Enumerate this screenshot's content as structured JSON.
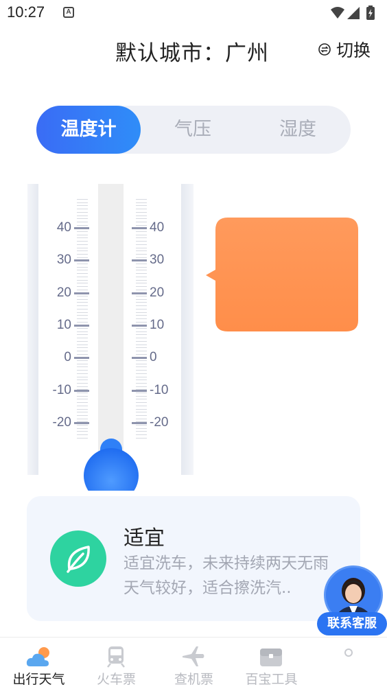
{
  "status_bar": {
    "time": "10:27",
    "notif_letter": "A"
  },
  "header": {
    "title": "默认城市：广州",
    "switch_label": "切换"
  },
  "tabs": [
    {
      "label": "温度计",
      "active": true
    },
    {
      "label": "气压",
      "active": false
    },
    {
      "label": "湿度",
      "active": false
    }
  ],
  "thermometer": {
    "scale_labels": [
      "40",
      "30",
      "20",
      "10",
      "0",
      "-10",
      "-20"
    ],
    "bulb_color": "#2f80f7"
  },
  "bubble": {
    "color": "#ff9656"
  },
  "suggestion": {
    "title": "适宜",
    "desc": "适宜洗车，未来持续两天无雨天气较好，适合擦洗汽..",
    "icon": "leaf-icon",
    "icon_color": "#2ed3a0"
  },
  "service": {
    "label": "联系客服"
  },
  "nav": [
    {
      "label": "出行天气",
      "icon": "weather-icon",
      "active": true
    },
    {
      "label": "火车票",
      "icon": "train-icon",
      "active": false
    },
    {
      "label": "查机票",
      "icon": "plane-icon",
      "active": false
    },
    {
      "label": "百宝工具",
      "icon": "toolbox-icon",
      "active": false
    },
    {
      "label": "",
      "icon": "profile-icon",
      "active": false
    }
  ]
}
